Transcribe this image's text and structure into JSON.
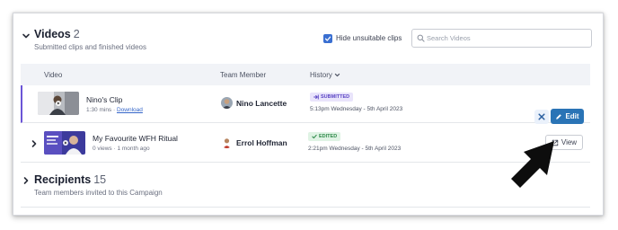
{
  "videos_section": {
    "title": "Videos",
    "count": "2",
    "subtitle": "Submitted clips and finished videos",
    "hide_unsuitable_label": "Hide unsuitable clips",
    "hide_unsuitable_checked": true,
    "search_placeholder": "Search Videos",
    "columns": {
      "video": "Video",
      "team_member": "Team Member",
      "history": "History"
    },
    "rows": [
      {
        "title": "Nino's Clip",
        "meta": "1:30 mins · ",
        "download_label": "Download",
        "member": "Nino Lancette",
        "badge": "SUBMITTED",
        "time": "5:13pm Wednesday - 5th April 2023",
        "edit_label": "Edit"
      },
      {
        "title": "My Favourite WFH Ritual",
        "meta": "0 views · 1 month ago",
        "member": "Errol Hoffman",
        "badge": "EDITED",
        "time": "2:21pm Wednesday - 5th April 2023",
        "view_label": "View"
      }
    ]
  },
  "recipients_section": {
    "title": "Recipients",
    "count": "15",
    "subtitle": "Team members invited to this Campaign"
  },
  "colors": {
    "accent_purple": "#6b55d6",
    "edit_blue": "#2a74b6",
    "checkbox_blue": "#3a6fd1",
    "submitted_bg": "#e9e4fb",
    "edited_bg": "#dff3e4"
  }
}
